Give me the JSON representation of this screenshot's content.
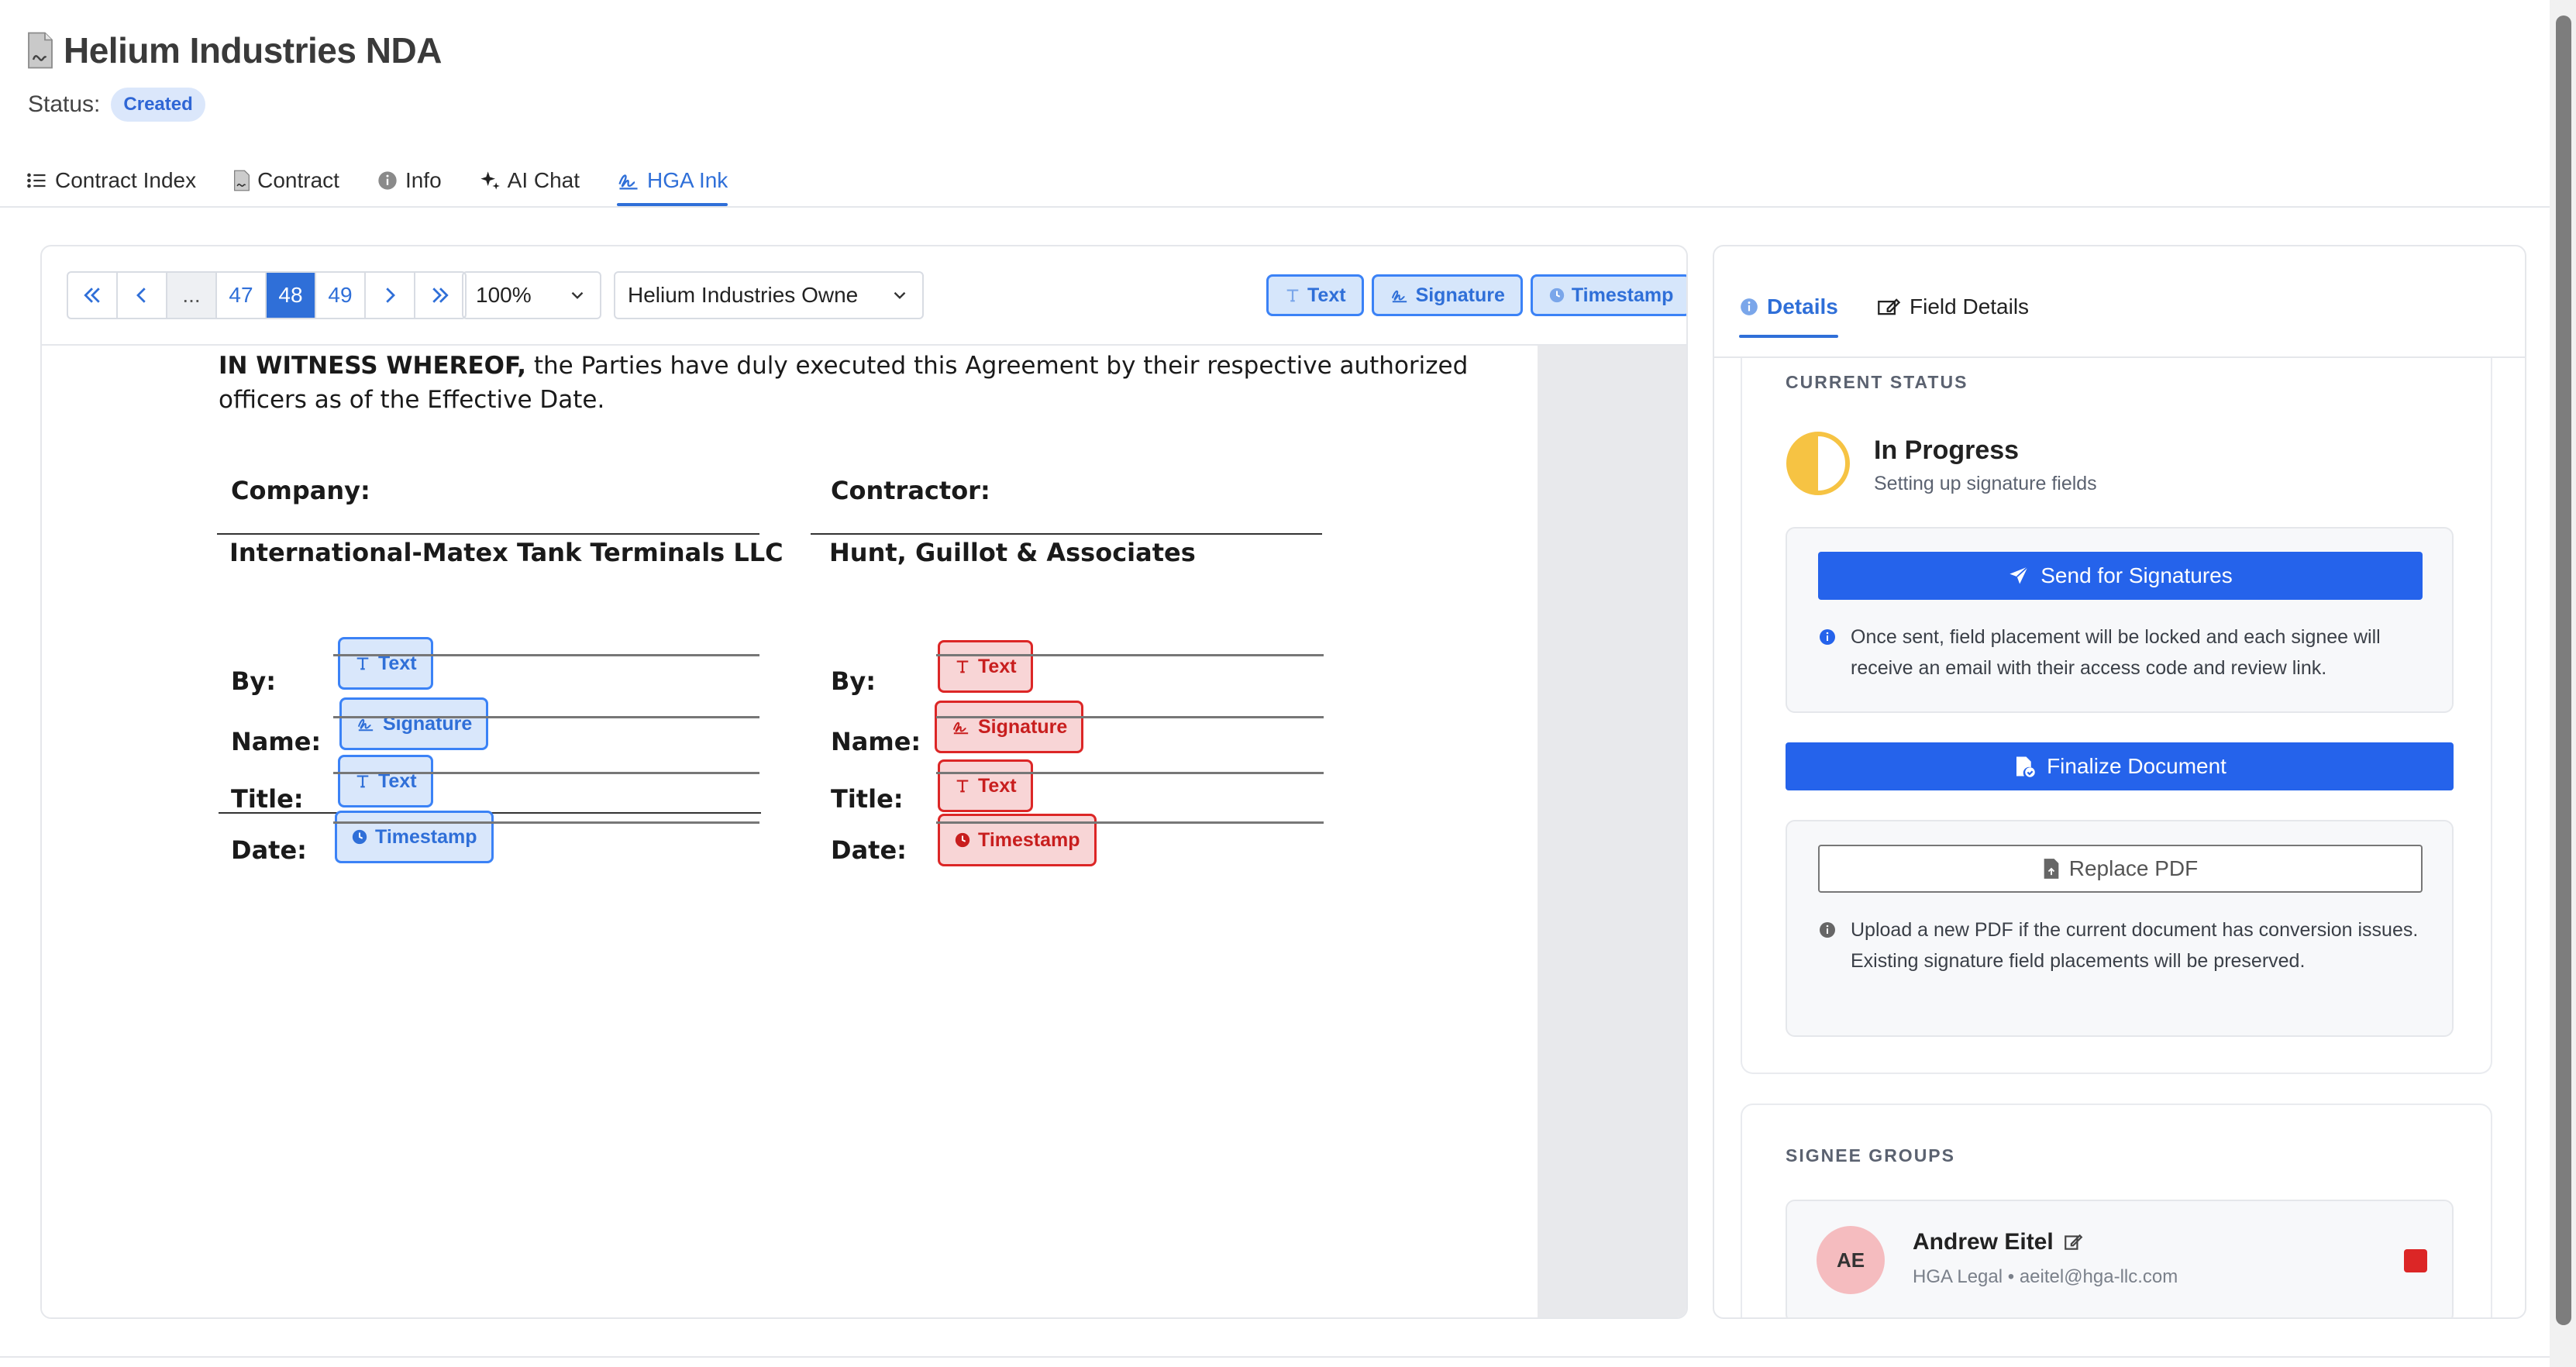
{
  "header": {
    "title": "Helium Industries NDA",
    "status_label": "Status:",
    "status_value": "Created"
  },
  "tabs": [
    {
      "label": "Contract Index",
      "icon": "list-icon"
    },
    {
      "label": "Contract",
      "icon": "pdf-file-icon"
    },
    {
      "label": "Info",
      "icon": "info-icon"
    },
    {
      "label": "AI Chat",
      "icon": "sparkle-icon"
    },
    {
      "label": "HGA Ink",
      "icon": "signature-icon",
      "active": true
    }
  ],
  "viewer": {
    "pager": {
      "first": "«",
      "prev": "‹",
      "ellipsis": "...",
      "pages": [
        "47",
        "48",
        "49"
      ],
      "current": "48",
      "next": "›",
      "last": "»"
    },
    "zoom": "100%",
    "signee": "Helium Industries Owne",
    "tools": {
      "text": "Text",
      "signature": "Signature",
      "timestamp": "Timestamp"
    },
    "document": {
      "witness_bold": "IN WITNESS WHEREOF,",
      "witness_rest": " the Parties have duly executed this Agreement by their respective authorized officers as of the Effective Date.",
      "company_head": "Company:",
      "company_name": "International-Matex Tank Terminals LLC",
      "contractor_head": "Contractor:",
      "contractor_name": "Hunt, Guillot & Associates",
      "labels": {
        "by": "By:",
        "name": "Name:",
        "title": "Title:",
        "date": "Date:"
      },
      "fields": {
        "text": "Text",
        "signature": "Signature",
        "timestamp": "Timestamp"
      }
    }
  },
  "side": {
    "tabs": {
      "details": "Details",
      "field_details": "Field Details"
    },
    "current_status_label": "CURRENT STATUS",
    "progress_title": "In Progress",
    "progress_sub": "Setting up signature fields",
    "send_button": "Send for Signatures",
    "send_note": "Once sent, field placement will be locked and each signee will receive an email with their access code and review link.",
    "finalize_button": "Finalize Document",
    "replace_button": "Replace PDF",
    "replace_note": "Upload a new PDF if the current document has conversion issues. Existing signature field placements will be preserved.",
    "groups_label": "SIGNEE GROUPS",
    "signee": {
      "initials": "AE",
      "name": "Andrew Eitel",
      "meta": "HGA Legal • aeitel@hga-llc.com",
      "color": "#dc2626"
    }
  },
  "colors": {
    "accent": "#2f6fd8",
    "primary_button": "#2563eb",
    "signee_blue": "#3b82f6",
    "signee_red": "#dc2626",
    "progress": "#f6c343"
  }
}
